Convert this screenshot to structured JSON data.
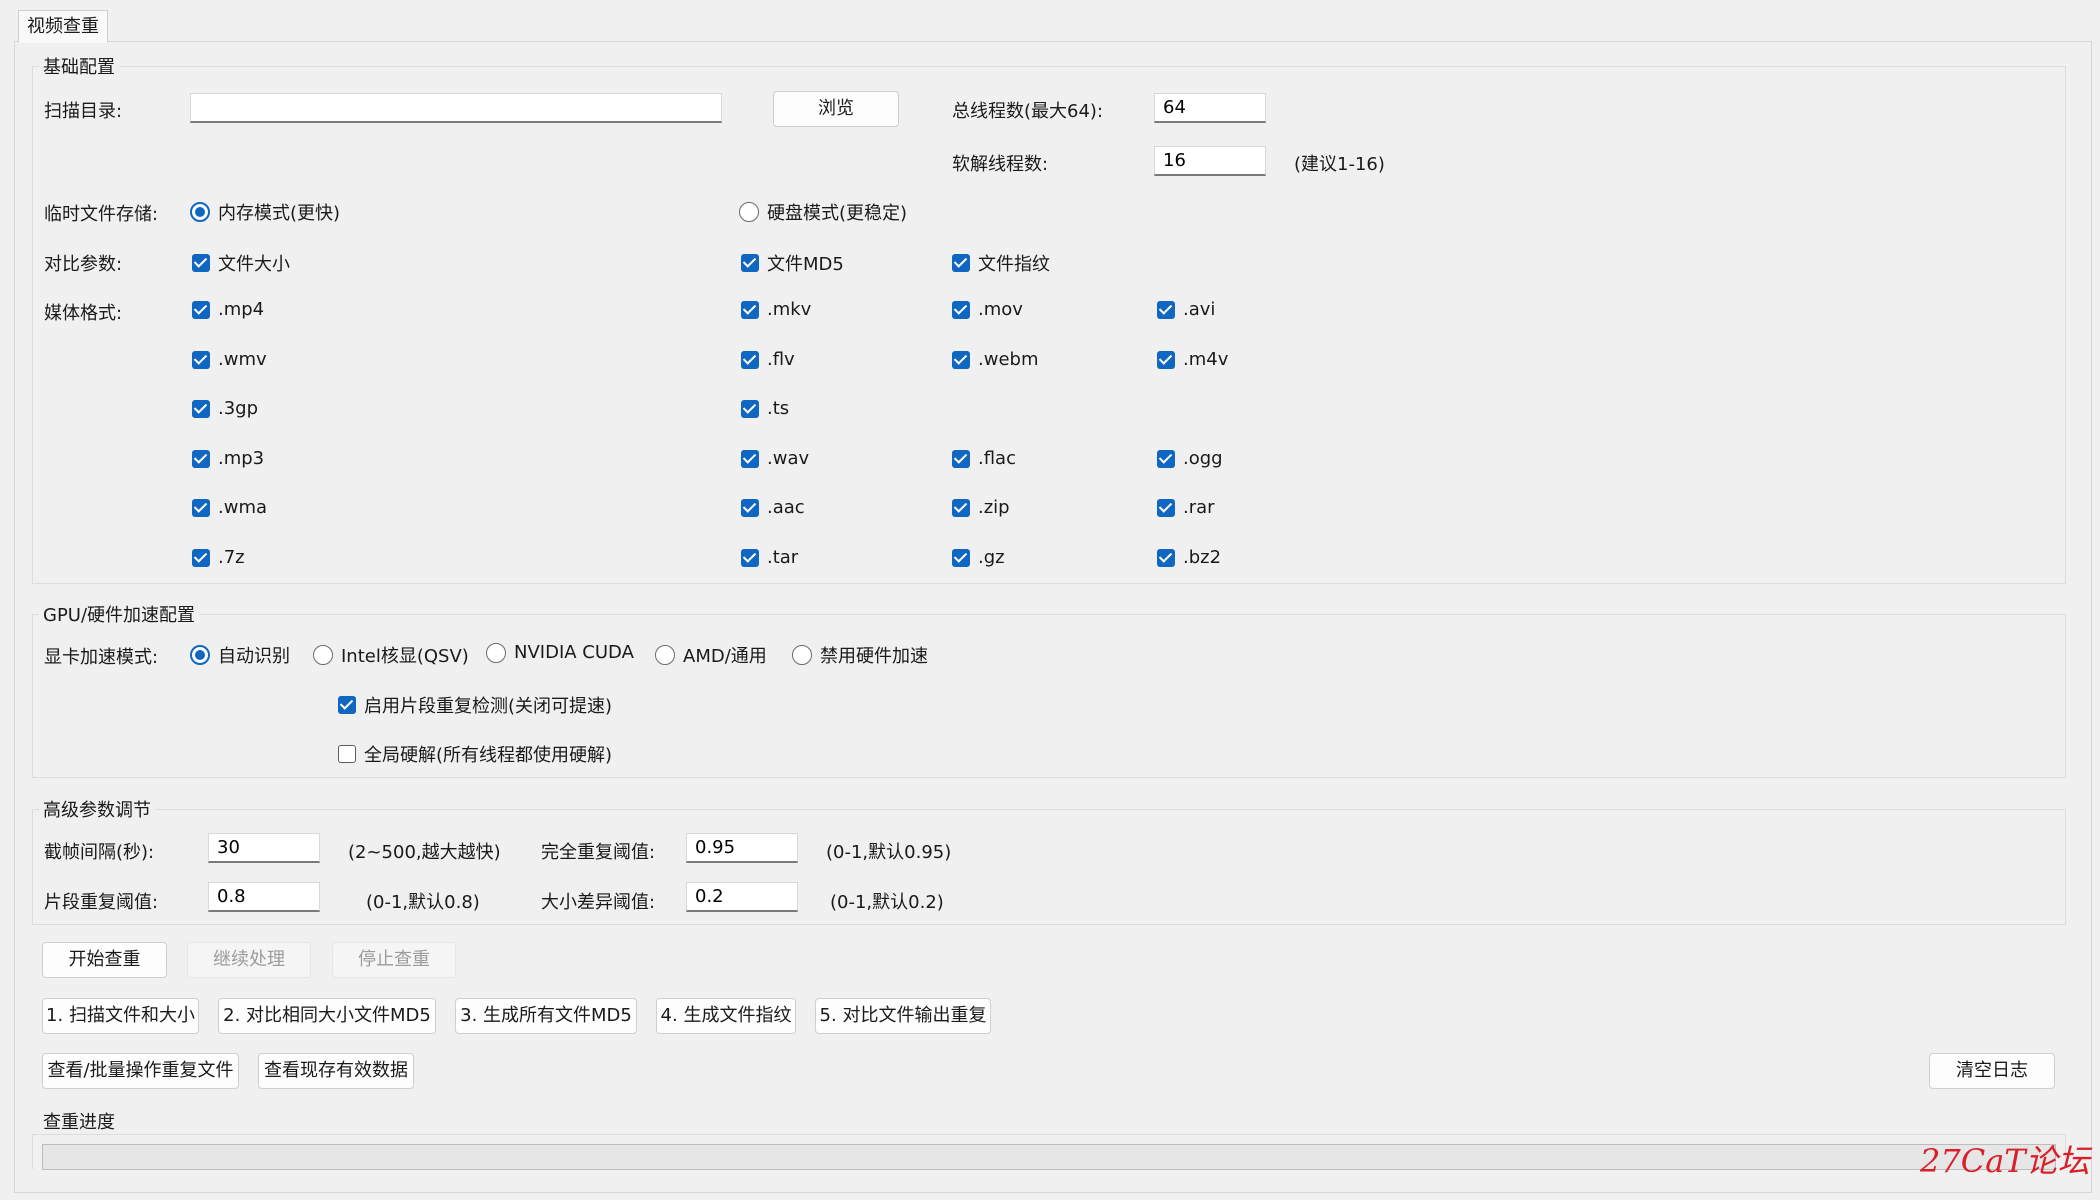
{
  "tab": {
    "title": "视频查重"
  },
  "basic": {
    "title": "基础配置",
    "scan_dir_label": "扫描目录:",
    "scan_dir_value": "",
    "browse_label": "浏览",
    "total_threads_label": "总线程数(最大64):",
    "total_threads_value": "64",
    "soft_threads_label": "软解线程数:",
    "soft_threads_value": "16",
    "soft_threads_hint": "(建议1-16)",
    "temp_label": "临时文件存储:",
    "temp_mem_label": "内存模式(更快)",
    "temp_disk_label": "硬盘模式(更稳定)",
    "compare_label": "对比参数:",
    "compare_size": "文件大小",
    "compare_md5": "文件MD5",
    "compare_fp": "文件指纹",
    "media_label": "媒体格式:",
    "formats": [
      ".mp4",
      ".mkv",
      ".mov",
      ".avi",
      ".wmv",
      ".flv",
      ".webm",
      ".m4v",
      ".3gp",
      ".ts",
      ".mp3",
      ".wav",
      ".flac",
      ".ogg",
      ".wma",
      ".aac",
      ".zip",
      ".rar",
      ".7z",
      ".tar",
      ".gz",
      ".bz2"
    ]
  },
  "gpu": {
    "title": "GPU/硬件加速配置",
    "mode_label": "显卡加速模式:",
    "modes": [
      "自动识别",
      "Intel核显(QSV)",
      "NVIDIA CUDA",
      "AMD/通用",
      "禁用硬件加速"
    ],
    "segment_check": "启用片段重复检测(关闭可提速)",
    "global_hw": "全局硬解(所有线程都使用硬解)"
  },
  "advanced": {
    "title": "高级参数调节",
    "interval_label": "截帧间隔(秒):",
    "interval_value": "30",
    "interval_hint": "(2~500,越大越快)",
    "full_label": "完全重复阈值:",
    "full_value": "0.95",
    "full_hint": "(0-1,默认0.95)",
    "segment_label": "片段重复阈值:",
    "segment_value": "0.8",
    "segment_hint": "(0-1,默认0.8)",
    "size_label": "大小差异阈值:",
    "size_value": "0.2",
    "size_hint": "(0-1,默认0.2)"
  },
  "actions": {
    "start": "开始查重",
    "resume": "继续处理",
    "stop": "停止查重",
    "step1": "1. 扫描文件和大小",
    "step2": "2. 对比相同大小文件MD5",
    "step3": "3. 生成所有文件MD5",
    "step4": "4. 生成文件指纹",
    "step5": "5. 对比文件输出重复",
    "view_dupes": "查看/批量操作重复文件",
    "view_valid": "查看现存有效数据",
    "clear_log": "清空日志"
  },
  "progress": {
    "title": "查重进度",
    "value": 0
  },
  "watermark": "27CaT论坛",
  "colors": {
    "accent": "#0f67c1",
    "watermark": "#d9202a"
  }
}
